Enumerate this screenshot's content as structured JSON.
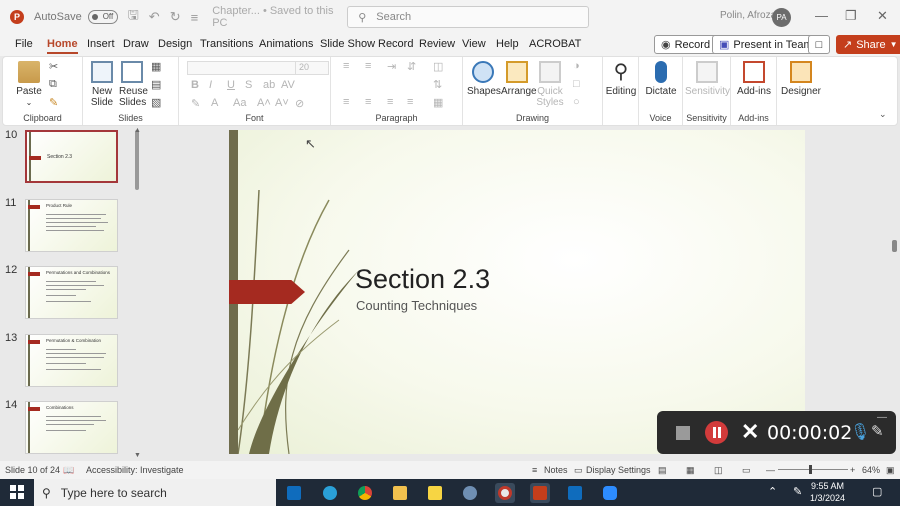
{
  "titlebar": {
    "autosave_label": "AutoSave",
    "autosave_state": "Off",
    "document_title": "Chapter... • Saved to this PC",
    "search_placeholder": "Search",
    "user_name": "Polin, Afroza",
    "user_initials": "PA"
  },
  "tabs": [
    "File",
    "Home",
    "Insert",
    "Draw",
    "Design",
    "Transitions",
    "Animations",
    "Slide Show",
    "Record",
    "Review",
    "View",
    "Help",
    "ACROBAT"
  ],
  "tab_buttons": {
    "record": "Record",
    "present": "Present in Teams",
    "share": "Share"
  },
  "ribbon": {
    "clipboard": {
      "paste": "Paste",
      "label": "Clipboard"
    },
    "slides": {
      "new_slide": "New Slide",
      "reuse_slides": "Reuse Slides",
      "label": "Slides"
    },
    "font": {
      "font_size": "20",
      "label": "Font"
    },
    "paragraph": {
      "label": "Paragraph"
    },
    "drawing": {
      "shapes": "Shapes",
      "arrange": "Arrange",
      "quick_styles": "Quick Styles",
      "label": "Drawing"
    },
    "editing": {
      "label": "Editing"
    },
    "voice": {
      "dictate": "Dictate",
      "label": "Voice"
    },
    "sensitivity": {
      "button": "Sensitivity",
      "label": "Sensitivity"
    },
    "addins": {
      "button": "Add-ins",
      "label": "Add-ins"
    },
    "designer": {
      "button": "Designer"
    }
  },
  "thumbnails": [
    {
      "num": "10",
      "title": "Section 2.3",
      "selected": true
    },
    {
      "num": "11",
      "title": "Product Rule",
      "selected": false
    },
    {
      "num": "12",
      "title": "Permutations and Combinations",
      "selected": false
    },
    {
      "num": "13",
      "title": "Permutation & Combination",
      "selected": false
    },
    {
      "num": "14",
      "title": "Combinations",
      "selected": false
    }
  ],
  "slide": {
    "title": "Section 2.3",
    "subtitle": "Counting Techniques"
  },
  "recorder": {
    "time": "00:00:02"
  },
  "statusbar": {
    "slide_pos": "Slide 10 of 24",
    "accessibility": "Accessibility: Investigate",
    "notes": "Notes",
    "display_settings": "Display Settings",
    "zoom": "64%"
  },
  "taskbar": {
    "search_placeholder": "Type here to search",
    "time": "9:55 AM",
    "date": "1/3/2024",
    "apps": [
      "outlook-icon",
      "edge-icon",
      "chrome-icon",
      "file-explorer-icon",
      "sticky-notes-icon",
      "r-icon",
      "screen-recorder-icon",
      "powerpoint-icon",
      "mail-icon",
      "zoom-icon"
    ]
  },
  "colors": {
    "accent": "#b7472a",
    "share": "#c43e1c",
    "slide_arrow": "#a52a20",
    "taskbar": "#1f2a38"
  }
}
